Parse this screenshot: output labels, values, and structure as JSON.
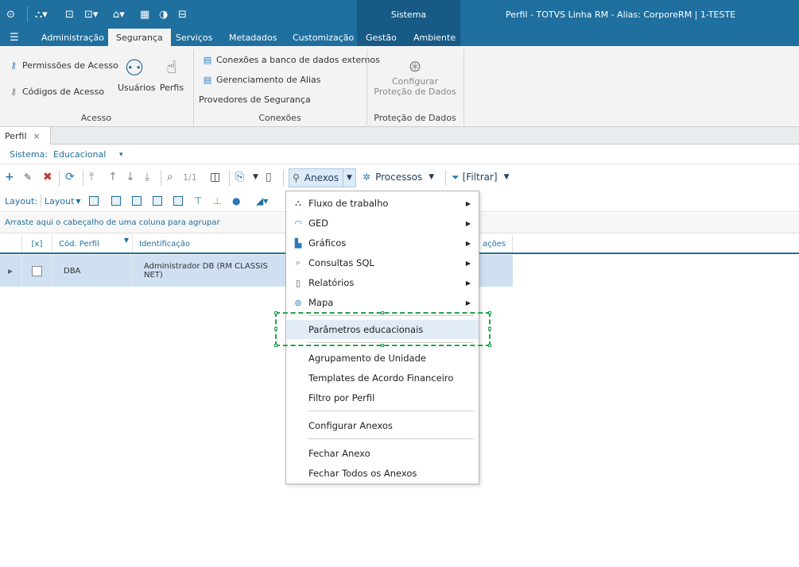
{
  "titlebar": {
    "sistema_tab": "Sistema",
    "title": "Perfil - TOTVS Linha RM -  Alias: CorporeRM | 1-TESTE",
    "qa_icons": [
      "logo-icon",
      "hierarchy-icon",
      "window-icon",
      "layout-icon",
      "home-icon",
      "grid-icon",
      "shield-icon",
      "exit-icon"
    ]
  },
  "menu": {
    "logo": "menu-icon",
    "tabs": [
      "Administração",
      "Segurança",
      "Serviços",
      "Metadados",
      "Customização",
      "Gestão",
      "Ambiente"
    ],
    "active": "Segurança"
  },
  "ribbon": {
    "acesso": {
      "permissoes": "Permissões de Acesso",
      "codigos": "Códigos de Acesso",
      "usuarios": "Usuários",
      "perfis": "Perfis",
      "group": "Acesso"
    },
    "conexoes": {
      "externos": "Conexões a banco de dados externos",
      "alias": "Gerenciamento de Alias",
      "provedores": "Provedores de Segurança",
      "group": "Conexões"
    },
    "protecao": {
      "configurar_1": "Configurar",
      "configurar_2": "Proteção de Dados",
      "group": "Proteção de Dados"
    }
  },
  "doc_tab": {
    "label": "Perfil",
    "close": "×"
  },
  "sistema": {
    "label": "Sistema:",
    "value": "Educacional",
    "arrow": "▾"
  },
  "toolbar": {
    "page": "1/1",
    "anexos": "Anexos",
    "processos": "Processos",
    "filtrar": "[Filtrar]"
  },
  "toolbar2": {
    "layout_label": "Layout:",
    "layout_button": "Layout"
  },
  "group_hint": "Arraste aqui o cabeçalho de uma coluna para agrupar",
  "grid": {
    "headers": [
      "[x]",
      "Cód. Perfil",
      "Identificação",
      "ações"
    ],
    "rows": [
      {
        "cod": "DBA",
        "identificacao": "Administrador DB (RM CLASSIS NET)"
      }
    ]
  },
  "dropdown": {
    "items": [
      {
        "label": "Fluxo de trabalho",
        "icon": "workflow-icon",
        "submenu": true
      },
      {
        "label": "GED",
        "icon": "ged-icon",
        "submenu": true
      },
      {
        "label": "Gráficos",
        "icon": "chart-icon",
        "submenu": true
      },
      {
        "label": "Consultas SQL",
        "icon": "search-icon",
        "submenu": true
      },
      {
        "label": "Relatórios",
        "icon": "report-icon",
        "submenu": true
      },
      {
        "label": "Mapa",
        "icon": "map-pin-icon",
        "submenu": true
      },
      {
        "label": "Parâmetros educacionais"
      },
      {
        "label": "Agrupamento de Unidade"
      },
      {
        "label": "Templates de Acordo Financeiro"
      },
      {
        "label": "Filtro por Perfil"
      },
      {
        "label": "Configurar Anexos"
      },
      {
        "label": "Fechar Anexo"
      },
      {
        "label": "Fechar Todos os Anexos"
      }
    ],
    "highlighted": "Parâmetros educacionais"
  }
}
